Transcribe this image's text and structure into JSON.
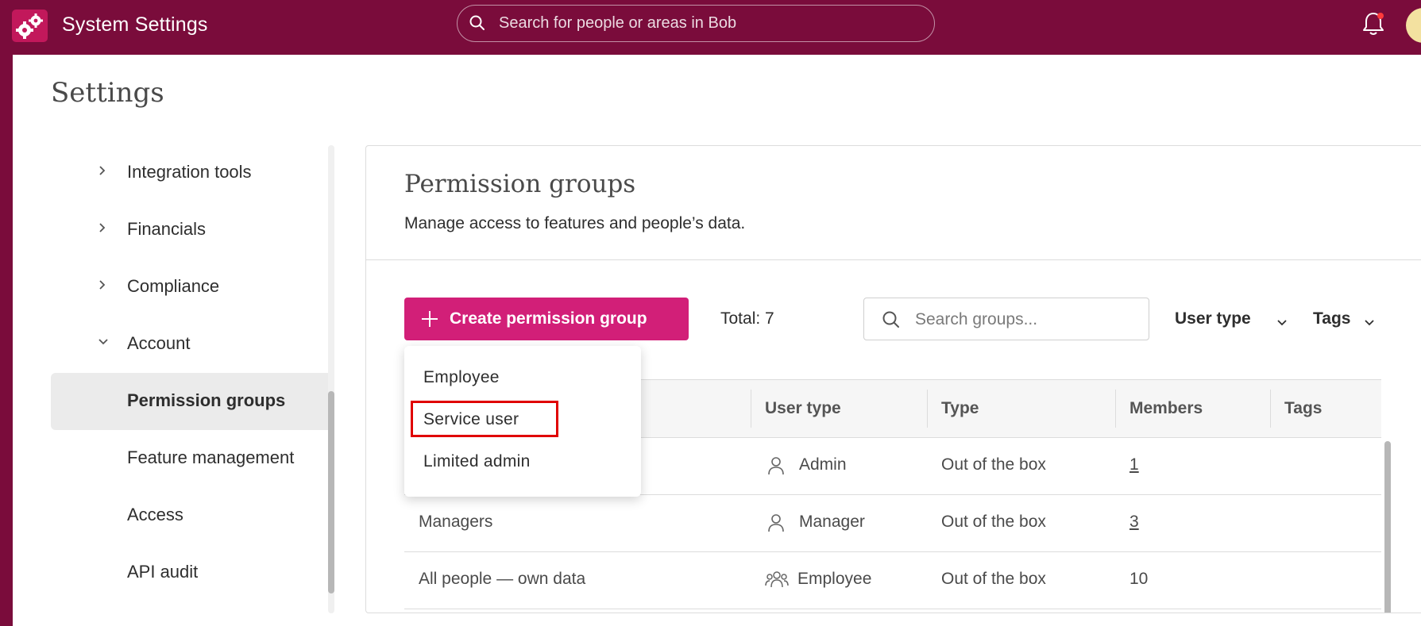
{
  "app": {
    "title": "System Settings",
    "search_placeholder": "Search for people or areas in Bob",
    "logo_icon": "gears-icon",
    "bell_icon": "bell-icon",
    "accent_color": "#7a0c3b"
  },
  "page": {
    "title": "Settings"
  },
  "sidebar": {
    "items": [
      {
        "label": "Integration tools",
        "chevron": "right"
      },
      {
        "label": "Financials",
        "chevron": "right"
      },
      {
        "label": "Compliance",
        "chevron": "right"
      },
      {
        "label": "Account",
        "chevron": "down"
      },
      {
        "label": "Permission groups",
        "active": true
      },
      {
        "label": "Feature management"
      },
      {
        "label": "Access"
      },
      {
        "label": "API audit"
      }
    ]
  },
  "content": {
    "title": "Permission groups",
    "subtitle": "Manage access to features and people’s data.",
    "create_button": "Create permission group",
    "create_button_color": "#d21f78",
    "total": "Total: 7",
    "search_placeholder": "Search groups...",
    "filters": [
      "User type",
      "Tags"
    ]
  },
  "dropdown": {
    "items": [
      "Employee",
      "Service user",
      "Limited admin"
    ],
    "highlighted": "Service user",
    "highlight_color": "#e00000"
  },
  "table": {
    "columns": [
      "User type",
      "Type",
      "Members",
      "Tags"
    ],
    "rows": [
      {
        "name": "",
        "user_type": "Admin",
        "user_icon": "person-icon",
        "type": "Out of the box",
        "members": "1",
        "members_link": true
      },
      {
        "name": "Managers",
        "user_type": "Manager",
        "user_icon": "person-icon",
        "type": "Out of the box",
        "members": "3",
        "members_link": true
      },
      {
        "name": "All people — own data",
        "user_type": "Employee",
        "user_icon": "people-icon",
        "type": "Out of the box",
        "members": "10",
        "members_link": false
      }
    ]
  }
}
